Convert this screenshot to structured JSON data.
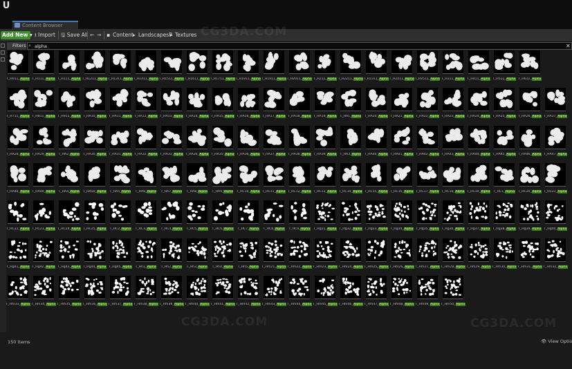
{
  "window": {
    "tab_title": "Content Browser"
  },
  "toolbar": {
    "add_new": "Add New ▾",
    "import": "Import",
    "save_all": "Save All",
    "breadcrumbs": [
      "Content",
      "LandscapesP",
      "Textures"
    ]
  },
  "search": {
    "filters_label": "Filters ▾",
    "value": "alpha",
    "clear": "✕"
  },
  "status": {
    "item_count": "150 items",
    "view_options": "View Options ▾"
  },
  "watermark": "CG3DA.COM",
  "rows": [
    {
      "prefix": [
        "T_H011_",
        "T_H111_",
        "T_H111_",
        "T_H1211_",
        "T_H1311_",
        "T_H1411_",
        "T_H1511_",
        "T_H1611_",
        "T_H1711_",
        "T_H1811_",
        "T_H1911_",
        "T_H2011_",
        "T_H211_",
        "T_H2211_",
        "T_H2311_",
        "T_H2411_",
        "T_H2511_",
        "T_H311_",
        "T_H411_",
        "T_H511_",
        "T_H611_"
      ],
      "alpha": "Alpha"
    },
    {
      "prefix": [
        "T_H711_",
        "T_H811_",
        "T_H911_",
        "T_HA10_",
        "T_HA11_",
        "T_HA12_",
        "T_HA13_",
        "T_HA14_",
        "T_HA15_",
        "T_HA16_",
        "T_HA17_",
        "T_HA18_",
        "T_HA19_",
        "T_HA1_",
        "T_HA20_",
        "T_HA21_",
        "T_HA22_",
        "T_HA23_",
        "T_HA24_",
        "T_HA25_",
        "T_HA26_",
        "T_HA27_"
      ],
      "alpha": "Alpha"
    },
    {
      "prefix": [
        "T_HA28_",
        "T_HA29_",
        "T_HA2_",
        "T_HA30_",
        "T_HA31_",
        "T_HA32_",
        "T_HA33_",
        "T_HA34_",
        "T_HA35_",
        "T_HA36_",
        "T_HA37_",
        "T_HA38_",
        "T_HA39_",
        "T_HA3_",
        "T_HA40_",
        "T_HA41_",
        "T_HA42_",
        "T_HA43_",
        "T_HA44_",
        "T_HA45_",
        "T_HA46_",
        "T_HA47_"
      ],
      "alpha": "Alpha"
    },
    {
      "prefix": [
        "T_HA48_",
        "T_HA49_",
        "T_HA4_",
        "T_HA50_",
        "T_HA5_",
        "T_HA6_",
        "T_HA7_",
        "T_HA8_",
        "T_HA9_",
        "T_HC10_",
        "T_HC11_",
        "T_HC12_",
        "T_HC13_",
        "T_HC14_",
        "T_HC15_",
        "T_HC16_",
        "T_HC17_",
        "T_HC18_",
        "T_HC19_",
        "T_HC1_",
        "T_HC20_",
        "T_HC21_"
      ],
      "alpha": "Alpha"
    },
    {
      "prefix": [
        "T_HC22_",
        "T_HC23_",
        "T_HC24_",
        "T_HC25_",
        "T_HC2_",
        "T_HC3_",
        "T_HC4_",
        "T_HC5_",
        "T_HC6_",
        "T_HC7_",
        "T_HC8_",
        "T_HC9_",
        "T_Hg31_",
        "T_Hg32_",
        "T_Hg33_",
        "T_Hg34_",
        "T_Hg35_",
        "T_Hg36_",
        "T_Hg37_",
        "T_Hg38_",
        "T_Hg39_",
        "T_Hg40_"
      ],
      "alpha": "Alpha"
    },
    {
      "prefix": [
        "T_Hg41_",
        "T_Hg42_",
        "T_Hg43_",
        "T_Hg44_",
        "T_Hg45_",
        "T_Hh1_",
        "T_Hh2_",
        "T_Hh3_",
        "T_Hh4_",
        "T_Hh5_",
        "T_Hm21_",
        "T_Hm22_",
        "T_Hm23_",
        "T_Hm24_",
        "T_Hm25_",
        "T_Hm26_",
        "T_Hm27_",
        "T_Hm28_",
        "T_Hm29_",
        "T_Hm30_",
        "T_Hm31_",
        "T_Hm32_"
      ],
      "alpha": "Alpha"
    },
    {
      "prefix": [
        "T_Hm33_",
        "T_Hm34_",
        "T_Hm35_",
        "T_Hm36_",
        "T_Hm37_",
        "T_Hm38_",
        "T_Hm39_",
        "T_Hm40_",
        "T_Hm41_",
        "T_Hm42_",
        "T_Hm43_",
        "T_Hm44_",
        "T_Hm45_",
        "T_Hm46_",
        "T_Hm47_",
        "T_Hm48_",
        "T_Hm49_",
        "T_Hm50_"
      ],
      "alpha": "Alpha"
    }
  ]
}
